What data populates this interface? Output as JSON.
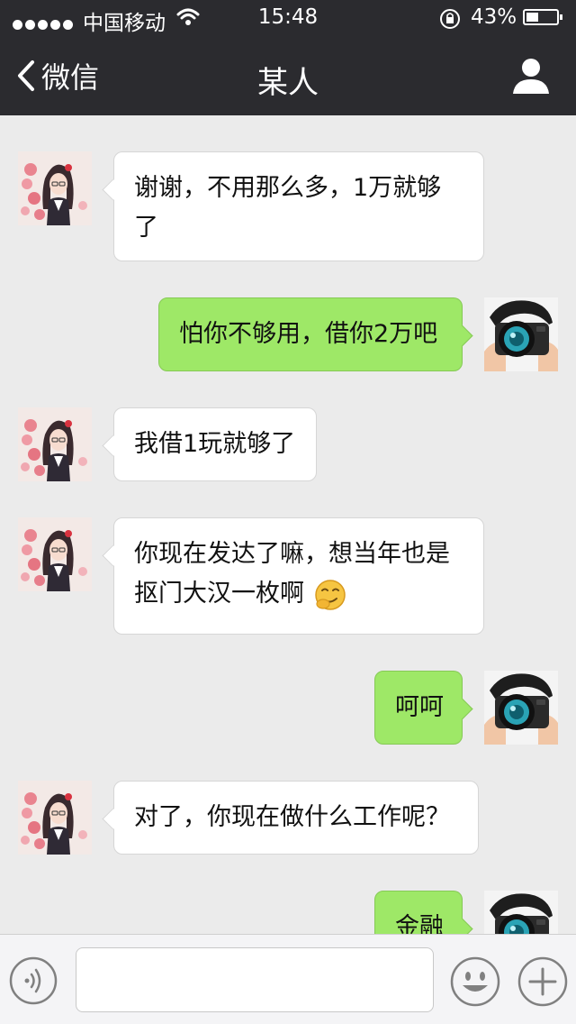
{
  "status_bar": {
    "carrier": "中国移动",
    "time": "15:48",
    "battery_percent": "43%",
    "battery_level": 0.43,
    "signal_dots": 5,
    "icons": [
      "signal-dots-icon",
      "wifi-icon",
      "rotation-lock-icon",
      "battery-icon"
    ]
  },
  "nav": {
    "back_label": "微信",
    "title": "某人",
    "icons": [
      "chevron-left-icon",
      "profile-icon"
    ]
  },
  "contact": {
    "avatar": "anime-girl-avatar",
    "me_avatar": "camera-man-avatar"
  },
  "messages": [
    {
      "side": "left",
      "text": "谢谢，不用那么多，1万就够了"
    },
    {
      "side": "right",
      "text": "怕你不够用，借你2万吧"
    },
    {
      "side": "left",
      "text": "我借1玩就够了"
    },
    {
      "side": "left",
      "text": "你现在发达了嘛，想当年也是抠门大汉一枚啊",
      "emoji": "smirk-face-emoji"
    },
    {
      "side": "right",
      "text": "呵呵"
    },
    {
      "side": "left",
      "text": "对了，你现在做什么工作呢？"
    },
    {
      "side": "right",
      "text": "金融"
    }
  ],
  "input_bar": {
    "text_value": "",
    "icons": [
      "voice-icon",
      "emoji-face-icon",
      "plus-icon"
    ]
  },
  "colors": {
    "header_bg": "#2b2b2f",
    "chat_bg": "#ebebeb",
    "outgoing_bubble": "#9ee867",
    "incoming_bubble": "#ffffff"
  }
}
